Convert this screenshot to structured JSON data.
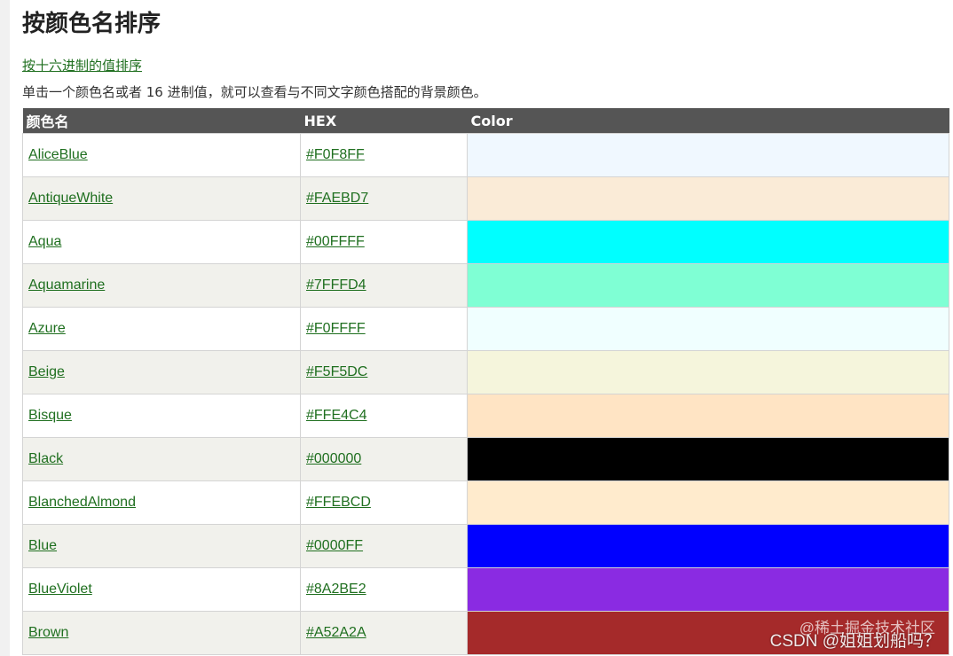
{
  "heading": "按颜色名排序",
  "sort_link": "按十六进制的值排序",
  "intro": "单击一个颜色名或者 16 进制值，就可以查看与不同文字颜色搭配的背景颜色。",
  "table": {
    "headers": [
      "颜色名",
      "HEX",
      "Color"
    ],
    "rows": [
      {
        "name": "AliceBlue",
        "hex": "#F0F8FF"
      },
      {
        "name": "AntiqueWhite",
        "hex": "#FAEBD7"
      },
      {
        "name": "Aqua",
        "hex": "#00FFFF"
      },
      {
        "name": "Aquamarine",
        "hex": "#7FFFD4"
      },
      {
        "name": "Azure",
        "hex": "#F0FFFF"
      },
      {
        "name": "Beige",
        "hex": "#F5F5DC"
      },
      {
        "name": "Bisque",
        "hex": "#FFE4C4"
      },
      {
        "name": "Black",
        "hex": "#000000"
      },
      {
        "name": "BlanchedAlmond",
        "hex": "#FFEBCD"
      },
      {
        "name": "Blue",
        "hex": "#0000FF"
      },
      {
        "name": "BlueViolet",
        "hex": "#8A2BE2"
      },
      {
        "name": "Brown",
        "hex": "#A52A2A"
      }
    ]
  },
  "watermark": {
    "top": "@稀土掘金技术社区",
    "bottom": "CSDN @姐姐划船吗？"
  },
  "colors": {
    "link": "#1f6f1f",
    "header_bg": "#555555"
  }
}
